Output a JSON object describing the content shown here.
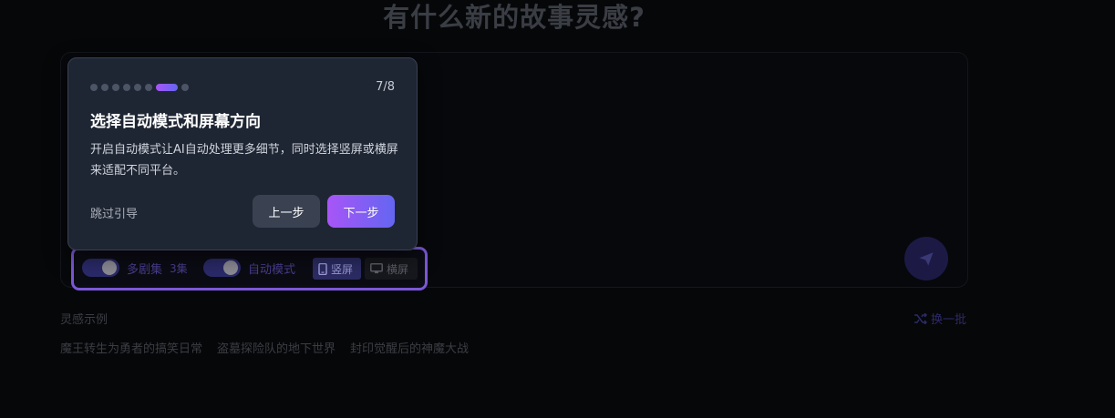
{
  "page": {
    "heading": "有什么新的故事灵感?"
  },
  "composer": {
    "multi_episode": {
      "label": "多剧集",
      "count": "3集",
      "enabled": true
    },
    "auto_mode": {
      "label": "自动模式",
      "enabled": true
    },
    "orientation": {
      "portrait_label": "竖屏",
      "landscape_label": "横屏",
      "selected": "portrait"
    },
    "send_icon": "paper-plane-icon"
  },
  "inspiration": {
    "label": "灵感示例",
    "refresh_label": "换一批",
    "refresh_icon": "shuffle-icon",
    "examples": [
      "魔王转生为勇者的搞笑日常",
      "盗墓探险队的地下世界",
      "封印觉醒后的神魔大战"
    ]
  },
  "tour": {
    "step_text": "7/8",
    "current_step": 7,
    "total_steps": 8,
    "title": "选择自动模式和屏幕方向",
    "description": "开启自动模式让AI自动处理更多细节，同时选择竖屏或横屏来适配不同平台。",
    "skip_label": "跳过引导",
    "prev_label": "上一步",
    "next_label": "下一步",
    "accent_colors": [
      "#a855f7",
      "#6366f1"
    ],
    "highlight_color": "#7b57d8"
  }
}
